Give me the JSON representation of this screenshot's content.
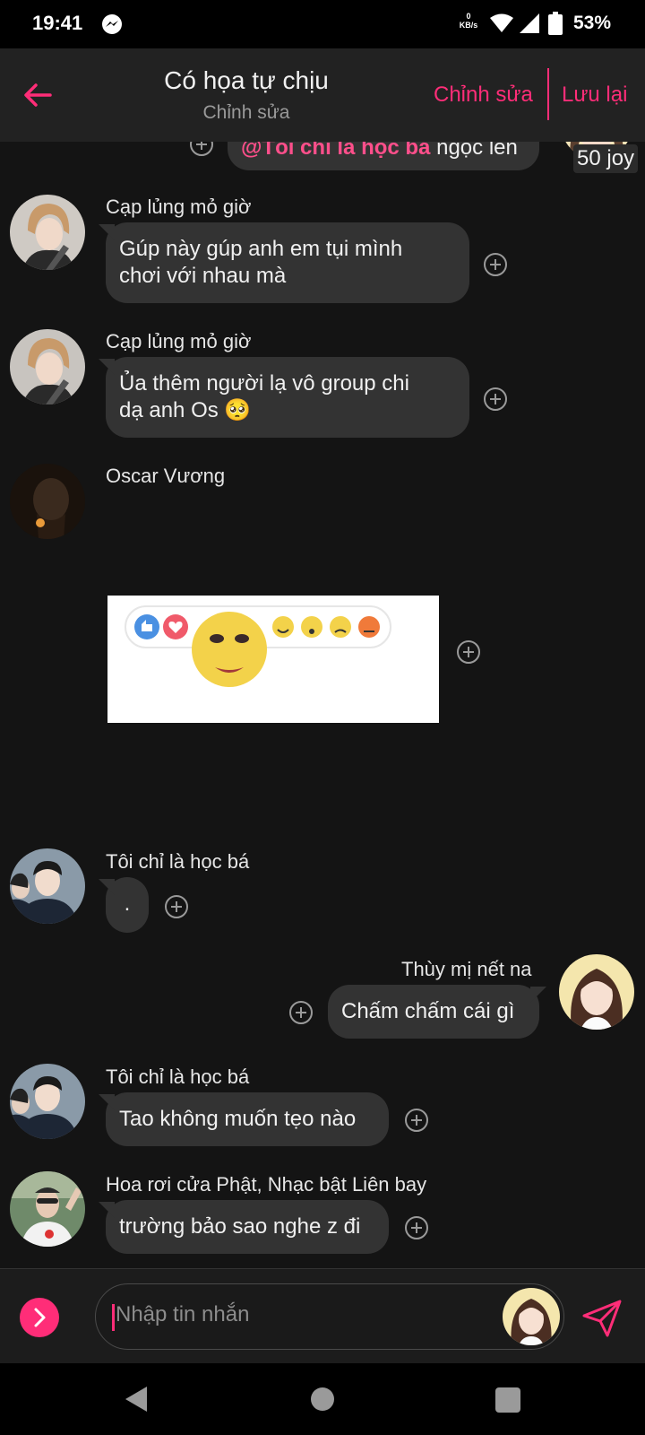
{
  "status_bar": {
    "time": "19:41",
    "net_speed_value": "0",
    "net_speed_unit": "KB/s",
    "battery": "53%",
    "icons": [
      "messenger-icon",
      "wifi-icon",
      "cell-signal-icon",
      "battery-icon"
    ]
  },
  "header": {
    "title": "Có họa tự chịu",
    "subtitle": "Chỉnh sửa",
    "edit_label": "Chỉnh sửa",
    "save_label": "Lưu lại",
    "accent": "#ff2d78"
  },
  "chat": {
    "partial_message": {
      "mention": "@Tôi chỉ là học bá",
      "text": " ngọc lên"
    },
    "reaction_tag": "50 joy",
    "messages": [
      {
        "sender": "Cạp lủng mỏ giờ",
        "lines": [
          "Gúp này gúp anh em tụi mình",
          "chơi với nhau mà"
        ]
      },
      {
        "sender": "Cạp lủng mỏ giờ",
        "lines": [
          "Ủa thêm người lạ vô group chi",
          "dạ anh Os 🥺"
        ]
      },
      {
        "sender": "Oscar Vương",
        "type": "sticker",
        "sticker": "reaction-emoji-sticker"
      },
      {
        "sender": "Tôi chỉ là học bá",
        "text": "."
      },
      {
        "sender": "Thùy mị nết na",
        "text": "Chấm chấm cái gì",
        "outgoing": true
      },
      {
        "sender": "Tôi chỉ là học bá",
        "text": "Tao không muốn tẹo nào"
      },
      {
        "sender": "Hoa rơi cửa Phật, Nhạc bật Liên bay",
        "text": "trường bảo sao nghe z đi"
      }
    ]
  },
  "input": {
    "placeholder": "Nhập tin nhắn"
  }
}
